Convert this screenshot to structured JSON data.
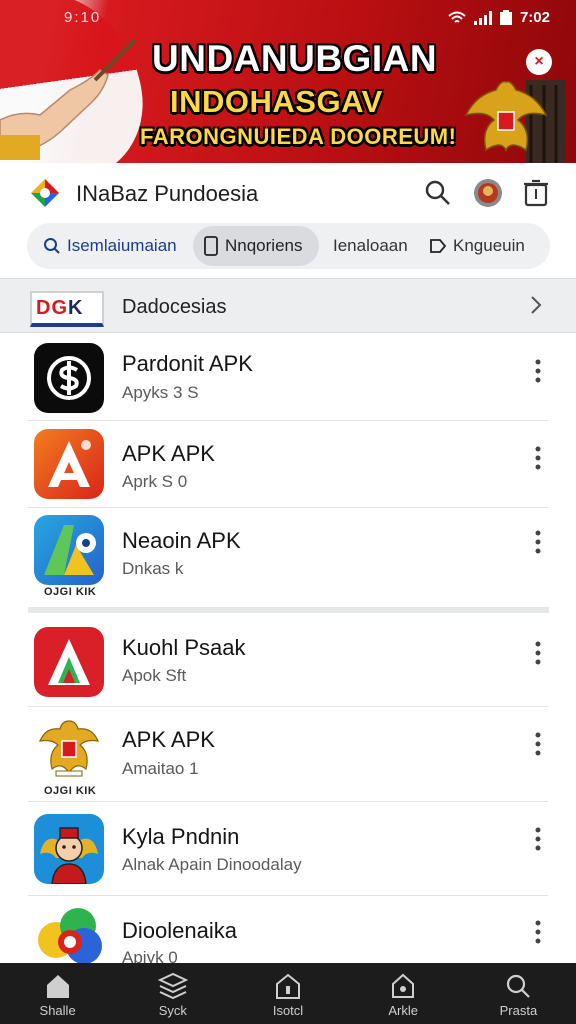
{
  "status_bar": {
    "left_text": "9:10",
    "time": "7:02"
  },
  "banner": {
    "line1": "UNDANUBGIAN",
    "line2": "INDOHASGAV",
    "line3": "FARONGNUIEDA DOOREUM!",
    "close_label": "×"
  },
  "app_bar": {
    "title": "INaBaz Pundoesia"
  },
  "chips": [
    {
      "label": "Isemlaiumaian"
    },
    {
      "label": "Nnqoriens"
    },
    {
      "label": "Ienaloaan"
    },
    {
      "label": "Kngueuin"
    }
  ],
  "section": {
    "badge_left": "DG",
    "badge_right": "K",
    "title": "Dadocesias"
  },
  "apps": [
    {
      "name": "Pardonit APK",
      "subtitle": "Apyks 3 S",
      "icon": "dollar-icon"
    },
    {
      "name": "APK APK",
      "subtitle": "Aprk S 0",
      "icon": "red-a-icon"
    },
    {
      "name": "Neaoin APK",
      "subtitle": "Dnkas k",
      "icon": "blue-a-icon",
      "caption": "OJGI KIK"
    },
    {
      "name": "Kuohl Psaak",
      "subtitle": "Apok Sft",
      "icon": "red-green-a-icon"
    },
    {
      "name": "APK APK",
      "subtitle": "Amaitao 1",
      "icon": "garuda-icon",
      "caption": "OJGI KIK"
    },
    {
      "name": "Kyla Pndnin",
      "subtitle": "Alnak Apain Dinoodalay",
      "icon": "boy-icon"
    },
    {
      "name": "Dioolenaika",
      "subtitle": "Apiyk 0",
      "icon": "colorful-blob-icon"
    }
  ],
  "bottom_nav": [
    {
      "label": "Shalle",
      "icon": "home-icon"
    },
    {
      "label": "Syck",
      "icon": "stack-icon"
    },
    {
      "label": "Isotcl",
      "icon": "house-outline-icon"
    },
    {
      "label": "Arkle",
      "icon": "tag-icon"
    },
    {
      "label": "Prasta",
      "icon": "search-icon"
    }
  ],
  "colors": {
    "brand_red": "#d71a1e",
    "banner_yellow": "#ffd84a",
    "nav_bg": "#1c1c1c",
    "link_blue": "#1a3e8c"
  }
}
